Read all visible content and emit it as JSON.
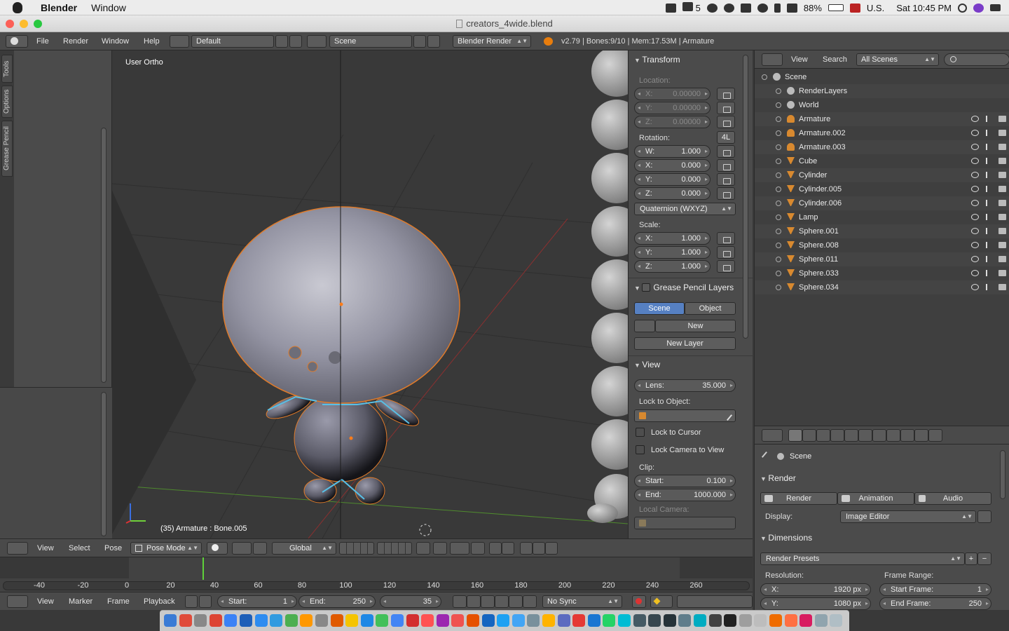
{
  "menubar": {
    "app_name": "Blender",
    "items": [
      "Window"
    ],
    "battery": "88%",
    "input_source": "U.S.",
    "clock": "Sat 10:45 PM",
    "ai_count": "5"
  },
  "window": {
    "title": "creators_4wide.blend"
  },
  "info_header": {
    "menus": [
      "File",
      "Render",
      "Window",
      "Help"
    ],
    "screen_layout": "Default",
    "scene": "Scene",
    "engine": "Blender Render",
    "stats": "v2.79 | Bones:9/10 | Mem:17.53M | Armature"
  },
  "toolshelf": {
    "tabs": [
      "Tools",
      "Options",
      "Grease Pencil"
    ]
  },
  "viewport": {
    "view_label": "User Ortho",
    "status": "(35) Armature : Bone.005"
  },
  "npanel": {
    "transform_title": "Transform",
    "location_label": "Location:",
    "location": [
      {
        "axis": "X:",
        "value": "0.00000"
      },
      {
        "axis": "Y:",
        "value": "0.00000"
      },
      {
        "axis": "Z:",
        "value": "0.00000"
      }
    ],
    "rotation_label": "Rotation:",
    "rotation_mode_badge": "4L",
    "rotation": [
      {
        "axis": "W:",
        "value": "1.000"
      },
      {
        "axis": "X:",
        "value": "0.000"
      },
      {
        "axis": "Y:",
        "value": "0.000"
      },
      {
        "axis": "Z:",
        "value": "0.000"
      }
    ],
    "rotation_mode": "Quaternion (WXYZ)",
    "scale_label": "Scale:",
    "scale": [
      {
        "axis": "X:",
        "value": "1.000"
      },
      {
        "axis": "Y:",
        "value": "1.000"
      },
      {
        "axis": "Z:",
        "value": "1.000"
      }
    ],
    "grease_title": "Grease Pencil Layers",
    "grease_scene": "Scene",
    "grease_object": "Object",
    "grease_new": "New",
    "grease_new_layer": "New Layer",
    "view_title": "View",
    "lens_label": "Lens:",
    "lens_value": "35.000",
    "lock_to_object": "Lock to Object:",
    "lock_to_cursor": "Lock to Cursor",
    "lock_camera": "Lock Camera to View",
    "clip_label": "Clip:",
    "clip_start_label": "Start:",
    "clip_start": "0.100",
    "clip_end_label": "End:",
    "clip_end": "1000.000",
    "local_camera": "Local Camera:"
  },
  "outliner": {
    "menus": [
      "View",
      "Search"
    ],
    "filter": "All Scenes",
    "rows": [
      {
        "name": "Scene",
        "indent": 0
      },
      {
        "name": "RenderLayers",
        "indent": 1
      },
      {
        "name": "World",
        "indent": 1
      },
      {
        "name": "Armature",
        "indent": 1
      },
      {
        "name": "Armature.002",
        "indent": 1
      },
      {
        "name": "Armature.003",
        "indent": 1
      },
      {
        "name": "Cube",
        "indent": 1
      },
      {
        "name": "Cylinder",
        "indent": 1
      },
      {
        "name": "Cylinder.005",
        "indent": 1
      },
      {
        "name": "Cylinder.006",
        "indent": 1
      },
      {
        "name": "Lamp",
        "indent": 1
      },
      {
        "name": "Sphere.001",
        "indent": 1
      },
      {
        "name": "Sphere.008",
        "indent": 1
      },
      {
        "name": "Sphere.011",
        "indent": 1
      },
      {
        "name": "Sphere.033",
        "indent": 1
      },
      {
        "name": "Sphere.034",
        "indent": 1
      }
    ]
  },
  "properties": {
    "context": "Scene",
    "render_title": "Render",
    "render_btn": "Render",
    "animation_btn": "Animation",
    "audio_btn": "Audio",
    "display_label": "Display:",
    "display_value": "Image Editor",
    "dimensions_title": "Dimensions",
    "presets": "Render Presets",
    "resolution_label": "Resolution:",
    "res_x_label": "X:",
    "res_x": "1920 px",
    "res_y_label": "Y:",
    "res_y": "1080 px",
    "frame_range_label": "Frame Range:",
    "start_frame_label": "Start Frame:",
    "start_frame": "1",
    "end_frame_label": "End Frame:",
    "end_frame": "250"
  },
  "view3d_header": {
    "menus": [
      "View",
      "Select",
      "Pose"
    ],
    "mode": "Pose Mode",
    "orientation": "Global"
  },
  "timeline": {
    "ticks": [
      "-40",
      "-20",
      "0",
      "20",
      "40",
      "60",
      "80",
      "100",
      "120",
      "140",
      "160",
      "180",
      "200",
      "220",
      "240",
      "260"
    ],
    "current_frame": 35
  },
  "timeline_header": {
    "menus": [
      "View",
      "Marker",
      "Frame",
      "Playback"
    ],
    "start_label": "Start:",
    "start": "1",
    "end_label": "End:",
    "end": "250",
    "current": "35",
    "sync": "No Sync"
  }
}
